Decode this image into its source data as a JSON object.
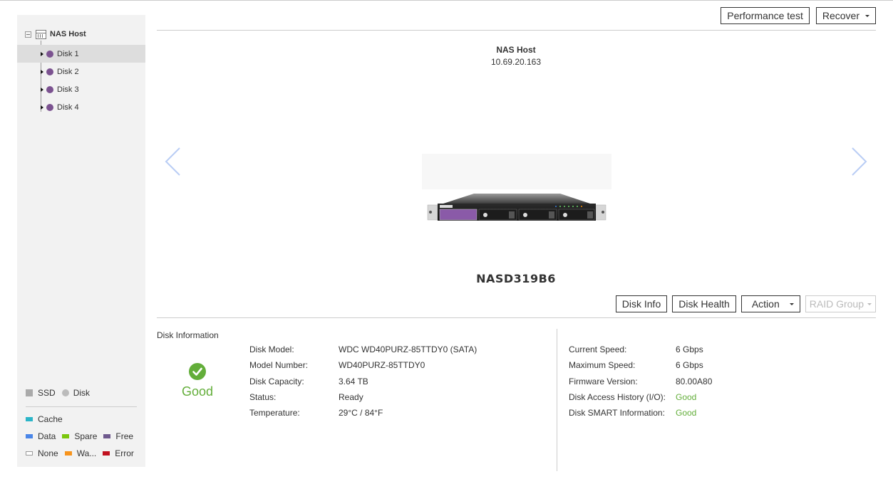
{
  "sidebar": {
    "root": {
      "label": "NAS Host",
      "icon": "nas-host-icon",
      "expanded": true
    },
    "items": [
      {
        "label": "Disk 1",
        "selected": true
      },
      {
        "label": "Disk 2",
        "selected": false
      },
      {
        "label": "Disk 3",
        "selected": false
      },
      {
        "label": "Disk 4",
        "selected": false
      }
    ],
    "disk_dot_color": "#7b5290",
    "legend": {
      "types": [
        {
          "label": "SSD",
          "shape": "square",
          "color": "#aaaaaa"
        },
        {
          "label": "Disk",
          "shape": "circle",
          "color": "#bbbbbb"
        }
      ],
      "roles": [
        {
          "label": "Cache",
          "color": "#2bb5c8"
        },
        {
          "label": "Data",
          "color": "#4a86e8"
        },
        {
          "label": "Spare",
          "color": "#7ac70c"
        },
        {
          "label": "Free",
          "color": "#6f5a8e"
        },
        {
          "label": "None",
          "color": "#ffffff"
        },
        {
          "label": "Wa...",
          "color": "#f7941d"
        },
        {
          "label": "Error",
          "color": "#c1121f"
        }
      ]
    }
  },
  "toolbar": {
    "performance_test_label": "Performance test",
    "recover_label": "Recover"
  },
  "device": {
    "host_name": "NAS Host",
    "host_ip": "10.69.20.163",
    "model_name": "NASD319B6"
  },
  "actions": {
    "disk_info_label": "Disk Info",
    "disk_health_label": "Disk Health",
    "action_label": "Action",
    "raid_group_label": "RAID Group",
    "raid_group_disabled": true
  },
  "disk_info": {
    "title": "Disk Information",
    "health_status": "Good",
    "health_color": "#63ae3a",
    "left": [
      {
        "key": "Disk Model:",
        "value": "WDC WD40PURZ-85TTDY0 (SATA)"
      },
      {
        "key": "Model Number:",
        "value": "WD40PURZ-85TTDY0"
      },
      {
        "key": "Disk Capacity:",
        "value": "3.64 TB"
      },
      {
        "key": "Status:",
        "value": "Ready"
      },
      {
        "key": "Temperature:",
        "value": "29°C / 84°F"
      }
    ],
    "right": [
      {
        "key": "Current Speed:",
        "value": "6 Gbps"
      },
      {
        "key": "Maximum Speed:",
        "value": "6 Gbps"
      },
      {
        "key": "Firmware Version:",
        "value": "80.00A80"
      },
      {
        "key": "Disk Access History (I/O):",
        "value": "Good",
        "status": "good"
      },
      {
        "key": "Disk SMART Information:",
        "value": "Good",
        "status": "good"
      }
    ]
  }
}
